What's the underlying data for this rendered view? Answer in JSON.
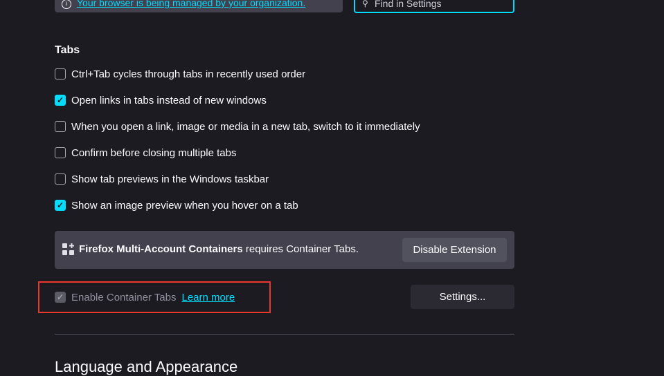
{
  "notice": {
    "text": "Your browser is being managed by your organization."
  },
  "search": {
    "placeholder": "Find in Settings"
  },
  "tabs": {
    "heading": "Tabs",
    "options": [
      {
        "label": "Ctrl+Tab cycles through tabs in recently used order",
        "checked": false
      },
      {
        "label": "Open links in tabs instead of new windows",
        "checked": true
      },
      {
        "label": "When you open a link, image or media in a new tab, switch to it immediately",
        "checked": false
      },
      {
        "label": "Confirm before closing multiple tabs",
        "checked": false
      },
      {
        "label": "Show tab previews in the Windows taskbar",
        "checked": false
      },
      {
        "label": "Show an image preview when you hover on a tab",
        "checked": true
      }
    ],
    "extension": {
      "name": "Firefox Multi-Account Containers",
      "suffix": " requires Container Tabs.",
      "button": "Disable Extension"
    },
    "container": {
      "label": "Enable Container Tabs",
      "learn_more": "Learn more",
      "settings": "Settings...",
      "checked": true,
      "disabled": true
    }
  },
  "next_section": {
    "heading": "Language and Appearance"
  },
  "colors": {
    "accent": "#00ddff",
    "background": "#1c1b22",
    "highlight": "#e8372c"
  }
}
